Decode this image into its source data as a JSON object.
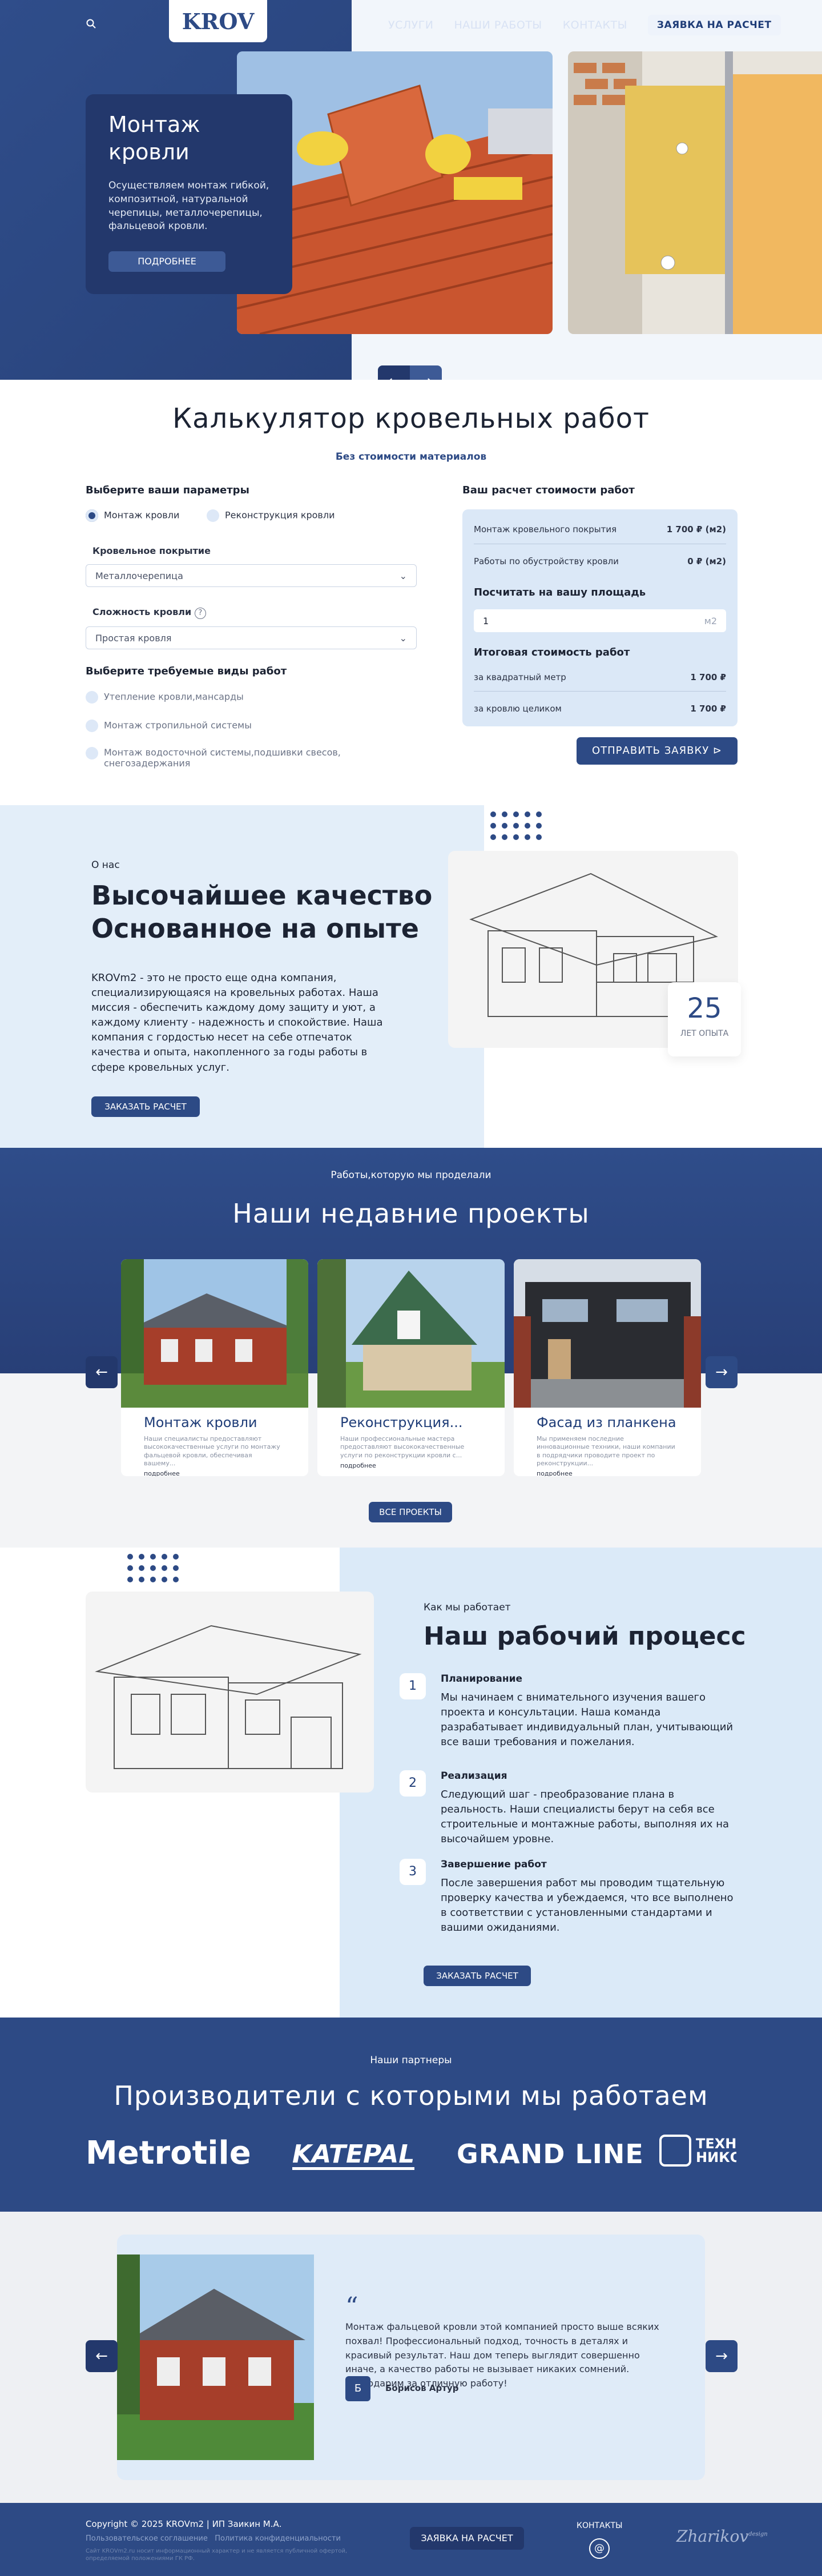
{
  "header": {
    "logo": "KROV",
    "nav": [
      "УСЛУГИ",
      "НАШИ РАБОТЫ",
      "КОНТАКТЫ"
    ],
    "cta": "ЗАЯВКА НА РАСЧЕТ"
  },
  "hero": {
    "title": "Монтаж кровли",
    "text": "Осуществляем монтаж гибкой, композитной, натуральной черепицы, металлочерепицы, фальцевой кровли.",
    "button": "ПОДРОБНЕЕ",
    "prev": "←",
    "next": "→"
  },
  "calculator": {
    "title": "Калькулятор кровельных работ",
    "subtitle": "Без стоимости материалов",
    "params_title": "Выберите ваши параметры",
    "type_options": [
      "Монтаж кровли",
      "Реконструкция кровли"
    ],
    "roof_label": "Кровельное покрытие",
    "roof_value": "Металлочерепица",
    "complexity_label": "Сложность кровли",
    "complexity_value": "Простая кровля",
    "works_title": "Выберите требуемые виды работ",
    "works": [
      "Утепление кровли,мансарды",
      "Монтаж стропильной системы",
      "Монтаж водосточной системы,подшивки свесов, снегозадержания"
    ],
    "result_title": "Ваш расчет стоимости работ",
    "rows": [
      {
        "label": "Монтаж кровельного покрытия",
        "value": "1 700 ₽ (м2)"
      },
      {
        "label": "Работы по обустройству кровли",
        "value": "0 ₽ (м2)"
      }
    ],
    "area_title": "Посчитать на вашу площадь",
    "area_value": "1",
    "area_unit": "м2",
    "total_title": "Итоговая стоимость работ",
    "totals": [
      {
        "label": "за квадратный метр",
        "value": "1 700 ₽"
      },
      {
        "label": "за кровлю целиком",
        "value": "1 700 ₽"
      }
    ],
    "submit": "ОТПРАВИТЬ ЗАЯВКУ"
  },
  "about": {
    "eyebrow": "О нас",
    "title_line1": "Высочайшее качество",
    "title_line2": "Основанное на опыте",
    "text": "KROVm2 - это не просто еще одна компания, специализирующаяся на кровельных работах. Наша миссия - обеспечить каждому дому защиту и уют, а каждому клиенту - надежность и спокойствие. Наша компания с гордостью несет на себе отпечаток качества и опыта, накопленного за годы работы в сфере кровельных услуг.",
    "button": "ЗАКАЗАТЬ РАСЧЕТ",
    "years": "25",
    "years_label": "ЛЕТ ОПЫТА"
  },
  "projects": {
    "eyebrow": "Работы,которую мы проделали",
    "title": "Наши недавние проекты",
    "cards": [
      {
        "title": "Монтаж кровли",
        "text": "Наши специалисты предоставляют высококачественные услуги по монтажу фальцевой кровли, обеспечивая вашему...",
        "more": "подробнее"
      },
      {
        "title": "Реконструкция...",
        "text": "Наши профессиональные мастера предоставляют высококачественные услуги по реконструкции кровли с...",
        "more": "подробнее"
      },
      {
        "title": "Фасад из планкена",
        "text": "Мы применяем последние инновационные техники, наши компании в подрядчики проводите проект по реконструкции...",
        "more": "подробнее"
      }
    ],
    "button": "ВСЕ ПРОЕКТЫ"
  },
  "process": {
    "eyebrow": "Как мы работает",
    "title": "Наш рабочий процесс",
    "steps": [
      {
        "num": "1",
        "title": "Планирование",
        "text": "Мы начинаем с внимательного изучения вашего проекта и консультации. Наша команда разрабатывает индивидуальный план, учитывающий все ваши требования и пожелания."
      },
      {
        "num": "2",
        "title": "Реализация",
        "text": "Следующий шаг - преобразование плана в реальность. Наши специалисты берут на себя все строительные и монтажные работы, выполняя их на высочайшем уровне."
      },
      {
        "num": "3",
        "title": "Завершение работ",
        "text": "После завершения работ мы проводим тщательную проверку качества и убеждаемся, что все выполнено в соответствии с установленными стандартами и вашими ожиданиями."
      }
    ],
    "button": "ЗАКАЗАТЬ РАСЧЕТ"
  },
  "partners": {
    "eyebrow": "Наши партнеры",
    "title": "Производители с которыми мы работаем",
    "logos": [
      "Metrotile",
      "KATEPAL",
      "GRAND LINE",
      "ТЕХН НИКО"
    ]
  },
  "testimonial": {
    "quote_mark": "“",
    "text": "Монтаж фальцевой кровли этой компанией просто выше всяких похвал! Профессиональный подход, точность в деталях и красивый результат. Наш дом теперь выглядит совершенно иначе, а качество работы не вызывает никаких сомнений. Благодарим за отличную работу!",
    "initial": "Б",
    "author": "Борисов Артур"
  },
  "footer": {
    "copyright": "Copyright © 2025 KROVm2 | ИП Заикин М.А.",
    "links": "Пользовательское соглашение   Политика конфиденциальности",
    "note": "Сайт KROVm2.ru носит информационный характер и не является публичной офертой, определяемой положениями ГК РФ.",
    "button": "ЗАЯВКА НА РАСЧЕТ",
    "contacts": "КОНТАКТЫ",
    "mail_icon": "@",
    "brand": "Zharikov",
    "brand_sup": "design"
  },
  "colors": {
    "primary": "#2d4a85",
    "dark": "#23386c",
    "light": "#e3eef9",
    "panel": "#dbe8f7"
  }
}
